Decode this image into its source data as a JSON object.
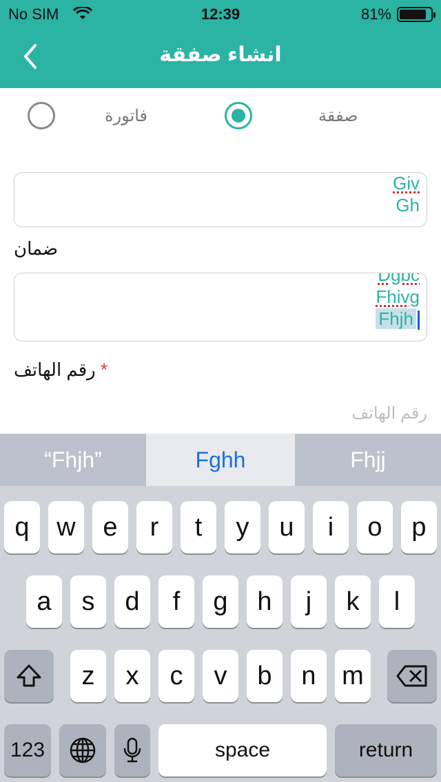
{
  "status_bar": {
    "carrier": "No SIM",
    "time": "12:39",
    "battery_percent": "81%",
    "battery_level": 0.81
  },
  "nav": {
    "title": "انشاء صفقة",
    "back_icon": "chevron-left-icon"
  },
  "type_selector": {
    "options": [
      {
        "label": "صفقة",
        "selected": true
      },
      {
        "label": "فاتورة",
        "selected": false
      }
    ]
  },
  "field_1": {
    "lines": [
      "Giv",
      "Gh"
    ]
  },
  "guarantee": {
    "label": "ضمان",
    "lines": [
      "Dgbc",
      "Fhivg",
      "Fhjh"
    ]
  },
  "phone": {
    "label": "رقم الهاتف",
    "required_mark": "*",
    "placeholder": "رقم الهاتف"
  },
  "keyboard": {
    "suggestions": [
      "“Fhjh”",
      "Fghh",
      "Fhjj"
    ],
    "row1": [
      "q",
      "w",
      "e",
      "r",
      "t",
      "y",
      "u",
      "i",
      "o",
      "p"
    ],
    "row2": [
      "a",
      "s",
      "d",
      "f",
      "g",
      "h",
      "j",
      "k",
      "l"
    ],
    "row3": [
      "z",
      "x",
      "c",
      "v",
      "b",
      "n",
      "m"
    ],
    "numbers_label": "123",
    "space_label": "space",
    "return_label": "return"
  },
  "colors": {
    "accent": "#2bb3a4",
    "required": "#e53935",
    "suggestion_highlight": "#1a6fe0"
  }
}
